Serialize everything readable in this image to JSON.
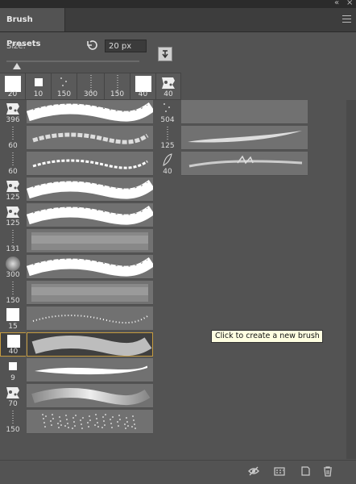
{
  "panel": {
    "title": "Brush Presets"
  },
  "size": {
    "label": "Size:",
    "value": "20 px"
  },
  "recent_brushes": [
    {
      "size": "20",
      "shape": "square-solid"
    },
    {
      "size": "10",
      "shape": "square-small"
    },
    {
      "size": "150",
      "shape": "scatter"
    },
    {
      "size": "300",
      "shape": "dot-line"
    },
    {
      "size": "150",
      "shape": "dot-line"
    },
    {
      "size": "40",
      "shape": "square-solid"
    },
    {
      "size": "40",
      "shape": "texture"
    }
  ],
  "brush_list": [
    {
      "size": "396",
      "shape": "texture",
      "stroke": "rough-thick"
    },
    {
      "size": "60",
      "shape": "dot-line",
      "stroke": "streaky"
    },
    {
      "size": "60",
      "shape": "dot-line",
      "stroke": "spatter-thin"
    },
    {
      "size": "125",
      "shape": "texture",
      "stroke": "rough-thick"
    },
    {
      "size": "125",
      "shape": "texture",
      "stroke": "rough-thick"
    },
    {
      "size": "131",
      "shape": "dot-line",
      "stroke": "fuzzy"
    },
    {
      "size": "300",
      "shape": "round-soft",
      "stroke": "rough-thick"
    },
    {
      "size": "150",
      "shape": "dot-line",
      "stroke": "fuzzy"
    },
    {
      "size": "15",
      "shape": "square-solid",
      "stroke": "dotted-thin"
    },
    {
      "size": "40",
      "shape": "square-solid",
      "stroke": "solid-gray",
      "selected": true
    },
    {
      "size": "9",
      "shape": "square-small",
      "stroke": "taper-white"
    },
    {
      "size": "70",
      "shape": "texture",
      "stroke": "soft-smear"
    },
    {
      "size": "150",
      "shape": "dot-line",
      "stroke": "sparkle"
    }
  ],
  "brush_list_col2": [
    {
      "size": "504",
      "shape": "scatter",
      "stroke": "none"
    },
    {
      "size": "125",
      "shape": "dot-line",
      "stroke": "fine-hair"
    },
    {
      "size": "40",
      "shape": "leaf",
      "stroke": "feather"
    }
  ],
  "tooltip": "Click to create a new brush",
  "icons": {
    "reset": "reset-icon",
    "new_preset": "new-preset-icon",
    "toggle_visibility": "eye-icon",
    "open_preset_manager": "grid-icon",
    "create_new": "new-brush-icon",
    "delete": "trash-icon"
  },
  "colors": {
    "panel_bg": "#535353",
    "stroke_bg": "#717171",
    "selected_border": "#c59b3f",
    "tooltip_bg": "#ffffe1"
  }
}
